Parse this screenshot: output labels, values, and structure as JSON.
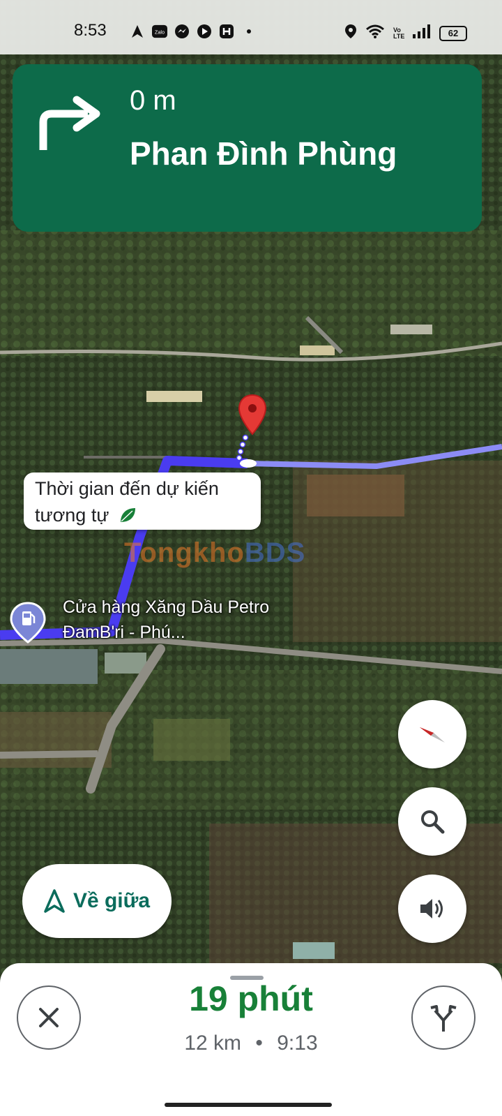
{
  "status_bar": {
    "time": "8:53",
    "battery": "62",
    "network_label": "Vo LTE",
    "left_icons": [
      "navigation-arrow-icon",
      "zalo-icon",
      "messenger-icon",
      "youtube-icon",
      "app-h-icon",
      "dot-icon"
    ],
    "right_icons": [
      "location-icon",
      "wifi-icon",
      "signal-icon",
      "battery-icon"
    ]
  },
  "navigation": {
    "maneuver_icon": "turn-right-icon",
    "distance": "0 m",
    "street": "Phan Đình Phùng",
    "banner_color": "#0d6b4a"
  },
  "map": {
    "eta_bubble_text": "Thời gian đến dự kiến tương tự",
    "eta_bubble_icon": "leaf-icon",
    "poi_label": "Cửa hàng Xăng Dầu Petro ĐamB'ri - Phú...",
    "poi_icon": "gas-station-icon",
    "watermark_part1": "Tongkho",
    "watermark_part2": "BDS",
    "route_color": "#4a3cf0"
  },
  "controls": {
    "compass_icon": "compass-icon",
    "search_icon": "search-icon",
    "sound_icon": "volume-icon",
    "recenter_label": "Về giữa",
    "recenter_icon": "recenter-arrow-icon"
  },
  "bottom_sheet": {
    "duration": "19 phút",
    "distance": "12 km",
    "separator": "•",
    "arrival_time": "9:13",
    "close_icon": "close-icon",
    "alt_routes_icon": "alternate-routes-icon",
    "accent_color": "#188038"
  }
}
